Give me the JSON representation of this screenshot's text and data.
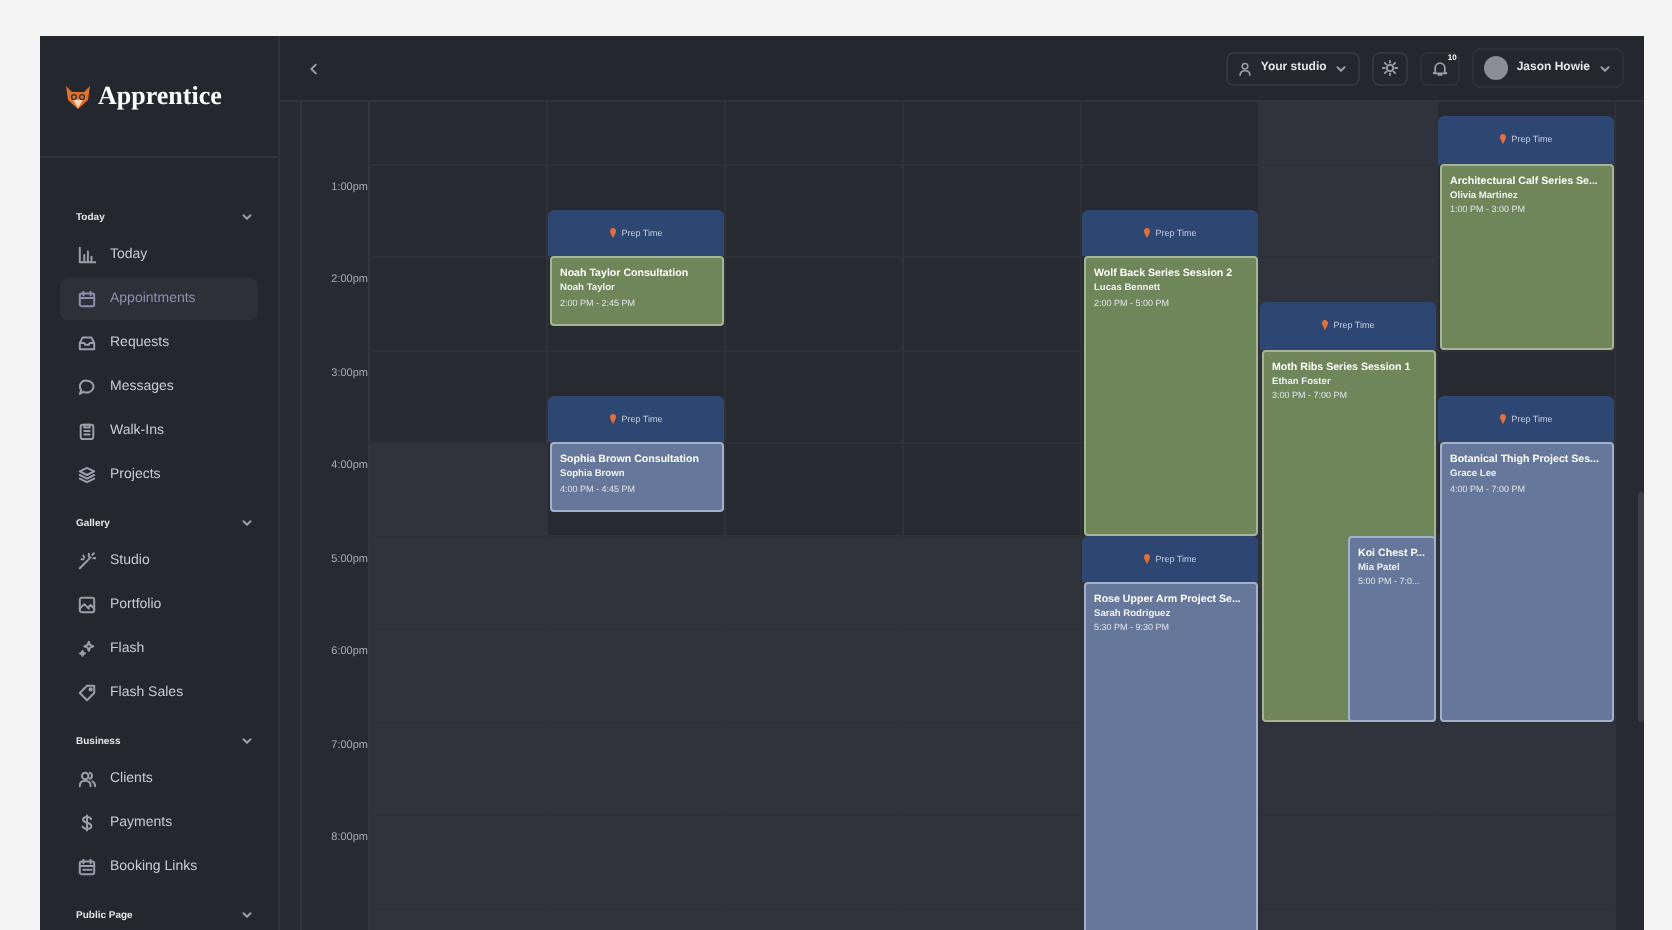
{
  "sidebar": {
    "logo": "Apprentice",
    "sections": [
      {
        "title": "Today",
        "expanded": true,
        "items": [
          {
            "label": "Today",
            "selected": false
          },
          {
            "label": "Appointments",
            "selected": true
          },
          {
            "label": "Requests",
            "selected": false
          },
          {
            "label": "Messages",
            "selected": false
          },
          {
            "label": "Walk-Ins",
            "selected": false
          },
          {
            "label": "Projects",
            "selected": false
          }
        ]
      },
      {
        "title": "Gallery",
        "expanded": true,
        "items": [
          {
            "label": "Studio",
            "selected": false
          },
          {
            "label": "Portfolio",
            "selected": false
          },
          {
            "label": "Flash",
            "selected": false
          },
          {
            "label": "Flash Sales",
            "selected": false
          }
        ]
      },
      {
        "title": "Business",
        "expanded": true,
        "items": [
          {
            "label": "Clients",
            "selected": false
          },
          {
            "label": "Payments",
            "selected": false
          },
          {
            "label": "Booking Links",
            "selected": false
          }
        ]
      },
      {
        "title": "Public Page",
        "expanded": true
      }
    ]
  },
  "header": {
    "studio": "Your studio",
    "notifications": "10",
    "user": "Jason Howie"
  },
  "calendar": {
    "time_labels": [
      "1:00pm",
      "2:00pm",
      "3:00pm",
      "4:00pm",
      "5:00pm",
      "6:00pm",
      "7:00pm",
      "8:00pm"
    ],
    "events": [
      {
        "title": "Noah Taylor Consultation",
        "client": "Noah Taylor",
        "time": "2:00 PM - 2:45 PM",
        "color": "#6e8659",
        "prep": "Prep Time"
      },
      {
        "title": "Sophia Brown Consultation",
        "client": "Sophia Brown",
        "time": "4:00 PM - 4:45 PM",
        "color": "#65779a",
        "prep": "Prep Time"
      },
      {
        "title": "Wolf Back Series Session 2",
        "client": "Lucas Bennett",
        "time": "2:00 PM - 5:00 PM",
        "color": "#6e8659",
        "prep": "Prep Time"
      },
      {
        "title": "Rose Upper Arm Project Se...",
        "client": "Sarah Rodriguez",
        "time": "5:30 PM - 9:30 PM",
        "color": "#65779a",
        "prep": "Prep Time"
      },
      {
        "title": "Moth Ribs Series Session 1",
        "client": "Ethan Foster",
        "time": "3:00 PM - 7:00 PM",
        "color": "#6e8659",
        "prep": "Prep Time"
      },
      {
        "title": "Koi Chest P...",
        "client": "Mia Patel",
        "time": "5:00 PM - 7:0...",
        "color": "#65779a"
      },
      {
        "title": "Architectural Calf Series Se...",
        "client": "Olivia Martinez",
        "time": "1:00 PM - 3:00 PM",
        "color": "#6e8659",
        "prep": "Prep Time"
      },
      {
        "title": "Botanical Thigh Project Ses...",
        "client": "Grace Lee",
        "time": "4:00 PM - 7:00 PM",
        "color": "#65779a",
        "prep": "Prep Time"
      }
    ]
  }
}
